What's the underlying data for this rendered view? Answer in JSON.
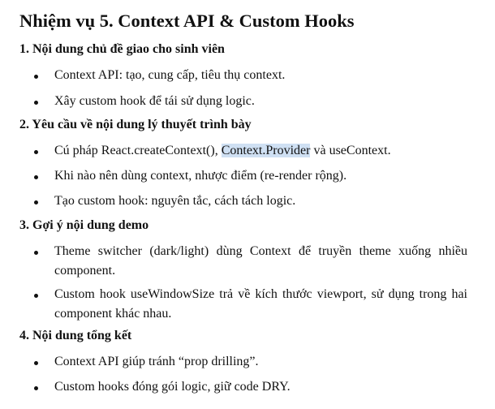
{
  "title": "Nhiệm vụ  5. Context API & Custom Hooks",
  "sections": [
    {
      "heading": "1. Nội dung chủ đề giao cho sinh viên",
      "items": [
        {
          "text": "Context API: tạo, cung cấp, tiêu thụ context."
        },
        {
          "text": "Xây custom hook để tái sử dụng logic."
        }
      ]
    },
    {
      "heading": "2. Yêu cầu về nội dung lý thuyết trình bày",
      "items": [
        {
          "text_before": "Cú pháp React.createContext(), ",
          "text_highlight": "Context.Provider",
          "text_after": " và useContext."
        },
        {
          "text": "Khi nào nên dùng context, nhược điểm (re-render rộng)."
        },
        {
          "text": "Tạo custom hook: nguyên tắc, cách tách logic."
        }
      ]
    },
    {
      "heading": "3. Gợi ý nội dung demo",
      "items": [
        {
          "text": "Theme switcher (dark/light) dùng Context để truyền theme xuống nhiều component."
        },
        {
          "text": "Custom hook useWindowSize trả về kích thước viewport, sử dụng trong hai component khác nhau."
        }
      ]
    },
    {
      "heading": "4. Nội dung tổng kết",
      "items": [
        {
          "text": "Context API giúp tránh “prop drilling”."
        },
        {
          "text": "Custom hooks đóng gói logic, giữ code DRY."
        }
      ]
    }
  ],
  "colors": {
    "text": "#111111",
    "selection_highlight": "#cfe0f3"
  }
}
